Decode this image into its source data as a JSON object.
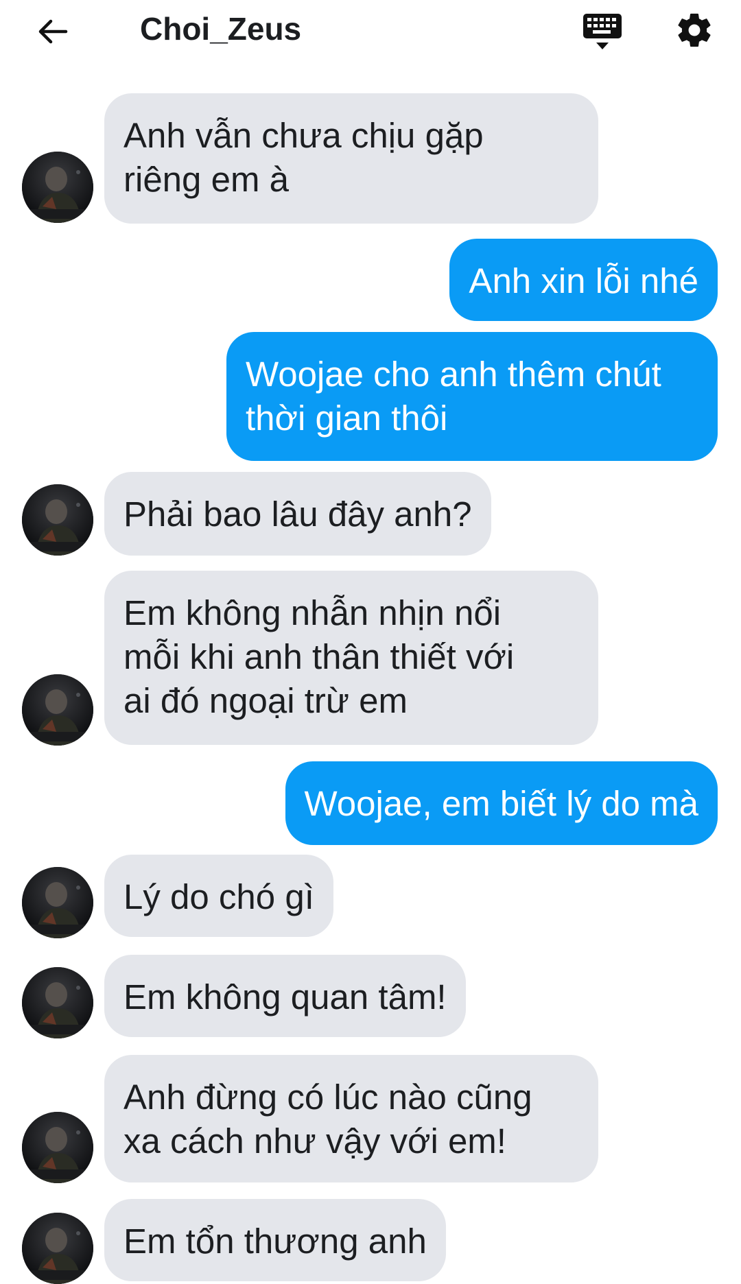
{
  "header": {
    "title": "Choi_Zeus",
    "icons": {
      "back": "arrow-left-icon",
      "keyboard": "keyboard-icon",
      "settings": "gear-icon"
    }
  },
  "colors": {
    "incoming_bubble": "#e4e6eb",
    "outgoing_bubble": "#0a9bf5",
    "outgoing_text": "#ffffff",
    "incoming_text": "#1c1e21"
  },
  "messages": [
    {
      "side": "in",
      "text": "Anh vẫn chưa chịu gặp\nriêng em à",
      "avatar": true
    },
    {
      "side": "out",
      "text": "Anh xin lỗi nhé"
    },
    {
      "side": "out",
      "text": "Woojae cho anh thêm chút\nthời gian thôi"
    },
    {
      "side": "in",
      "text": "Phải bao lâu đây anh?",
      "avatar": true
    },
    {
      "side": "in",
      "text": "Em không nhẫn nhịn nổi\nmỗi khi anh thân thiết với\nai đó ngoại trừ em",
      "avatar": true
    },
    {
      "side": "out",
      "text": "Woojae, em biết lý do mà"
    },
    {
      "side": "in",
      "text": "Lý do chó gì",
      "avatar": true
    },
    {
      "side": "in",
      "text": "Em không quan tâm!",
      "avatar": true
    },
    {
      "side": "in",
      "text": "Anh đừng có lúc nào cũng\nxa cách như vậy với em!",
      "avatar": true
    },
    {
      "side": "in",
      "text": "Em tổn thương anh",
      "avatar": true
    }
  ]
}
